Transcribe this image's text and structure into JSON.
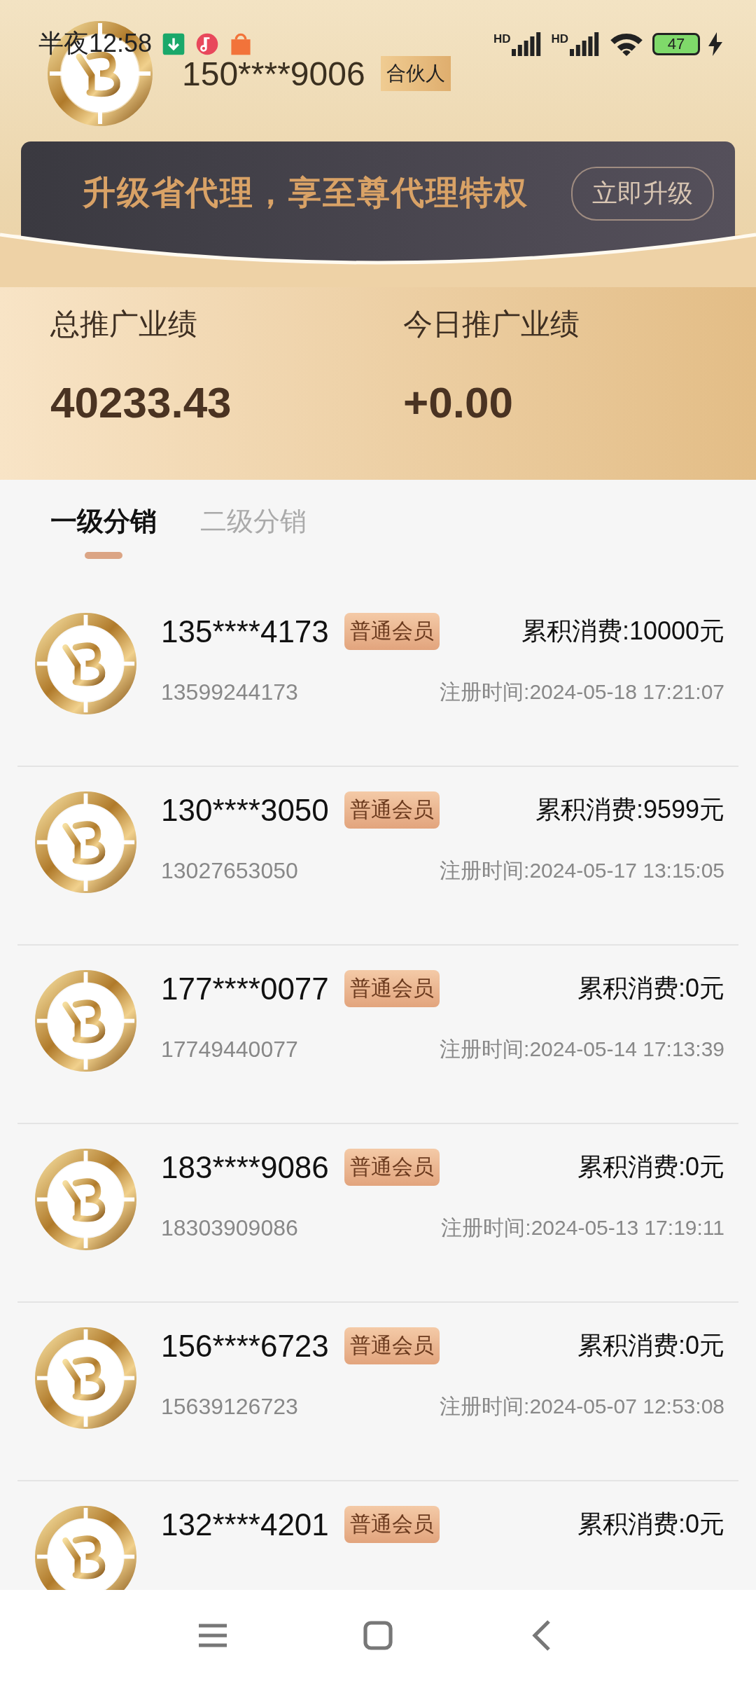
{
  "status_bar": {
    "time": "半夜12:58",
    "signals": [
      {
        "label": "HD"
      },
      {
        "label": "HD"
      }
    ],
    "battery": "47"
  },
  "profile": {
    "name": "150****9006",
    "badge": "合伙人"
  },
  "banner": {
    "text": "升级省代理，享至尊代理特权",
    "button": "立即升级"
  },
  "stats": [
    {
      "label": "总推广业绩",
      "value": "40233.43"
    },
    {
      "label": "今日推广业绩",
      "value": "+0.00"
    }
  ],
  "tabs": [
    {
      "label": "一级分销",
      "selected": true
    },
    {
      "label": "二级分销",
      "selected": false
    }
  ],
  "members": [
    {
      "name": "135****4173",
      "badge": "普通会员",
      "spend": "累积消费:10000元",
      "phone": "13599244173",
      "registered": "注册时间:2024-05-18 17:21:07"
    },
    {
      "name": "130****3050",
      "badge": "普通会员",
      "spend": "累积消费:9599元",
      "phone": "13027653050",
      "registered": "注册时间:2024-05-17 13:15:05"
    },
    {
      "name": "177****0077",
      "badge": "普通会员",
      "spend": "累积消费:0元",
      "phone": "17749440077",
      "registered": "注册时间:2024-05-14 17:13:39"
    },
    {
      "name": "183****9086",
      "badge": "普通会员",
      "spend": "累积消费:0元",
      "phone": "18303909086",
      "registered": "注册时间:2024-05-13 17:19:11"
    },
    {
      "name": "156****6723",
      "badge": "普通会员",
      "spend": "累积消费:0元",
      "phone": "15639126723",
      "registered": "注册时间:2024-05-07 12:53:08"
    },
    {
      "name": "132****4201",
      "badge": "普通会员",
      "spend": "累积消费:0元"
    }
  ]
}
